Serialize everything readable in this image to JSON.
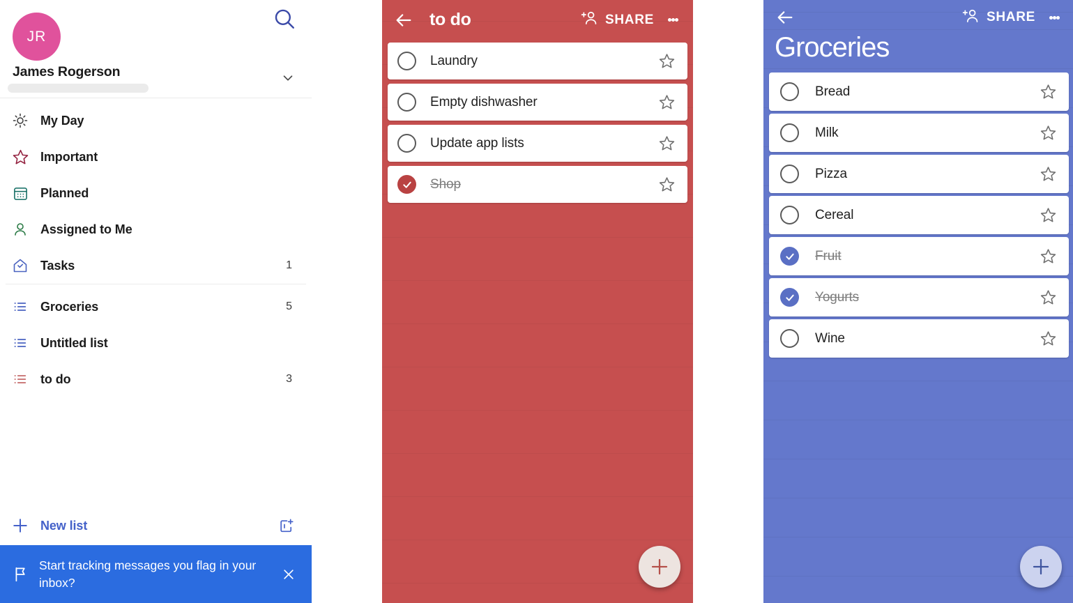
{
  "sidebar": {
    "search_icon": "search-icon",
    "account": {
      "initials": "JR",
      "name": "James Rogerson",
      "chevron_icon": "chevron-down-icon"
    },
    "nav": [
      {
        "label": "My Day",
        "icon": "sun-icon",
        "color": "#3a3a3a",
        "count": ""
      },
      {
        "label": "Important",
        "icon": "star-icon",
        "color": "#93213f",
        "count": ""
      },
      {
        "label": "Planned",
        "icon": "calendar-icon",
        "color": "#0f6b61",
        "count": ""
      },
      {
        "label": "Assigned to Me",
        "icon": "person-icon",
        "color": "#2a7a45",
        "count": ""
      },
      {
        "label": "Tasks",
        "icon": "home-check-icon",
        "color": "#4a63c0",
        "count": "1"
      }
    ],
    "lists": [
      {
        "label": "Groceries",
        "icon": "list-icon",
        "color": "#4a63c0",
        "count": "5"
      },
      {
        "label": "Untitled list",
        "icon": "list-icon",
        "color": "#4a63c0",
        "count": ""
      },
      {
        "label": "to do",
        "icon": "list-icon",
        "color": "#c56a6a",
        "count": "3"
      }
    ],
    "new_list": {
      "label": "New list",
      "plus_icon": "plus-icon",
      "new_group_icon": "new-group-icon",
      "color": "#4461c9"
    },
    "banner": {
      "text": "Start tracking messages you flag in your inbox?",
      "flag_icon": "flag-icon",
      "close_icon": "close-icon",
      "background": "#2b6ce0"
    }
  },
  "todo_panel": {
    "title": "to do",
    "theme": "#c64f4f",
    "back_icon": "back-arrow-icon",
    "share_label": "SHARE",
    "share_icon": "add-person-icon",
    "kebab_icon": "more-options-icon",
    "add_icon": "plus-icon",
    "tasks": [
      {
        "name": "Laundry",
        "done": false,
        "starred": false
      },
      {
        "name": "Empty dishwasher",
        "done": false,
        "starred": false
      },
      {
        "name": "Update app lists",
        "done": false,
        "starred": false
      },
      {
        "name": "Shop",
        "done": true,
        "starred": false
      }
    ]
  },
  "groceries_panel": {
    "title": "Groceries",
    "theme": "#6478cc",
    "back_icon": "back-arrow-icon",
    "share_label": "SHARE",
    "share_icon": "add-person-icon",
    "kebab_icon": "more-options-icon",
    "add_icon": "plus-icon",
    "tasks": [
      {
        "name": "Bread",
        "done": false,
        "starred": false
      },
      {
        "name": "Milk",
        "done": false,
        "starred": false
      },
      {
        "name": "Pizza",
        "done": false,
        "starred": false
      },
      {
        "name": "Cereal",
        "done": false,
        "starred": false
      },
      {
        "name": "Fruit",
        "done": true,
        "starred": false
      },
      {
        "name": "Yogurts",
        "done": true,
        "starred": false
      },
      {
        "name": "Wine",
        "done": false,
        "starred": false
      }
    ]
  }
}
